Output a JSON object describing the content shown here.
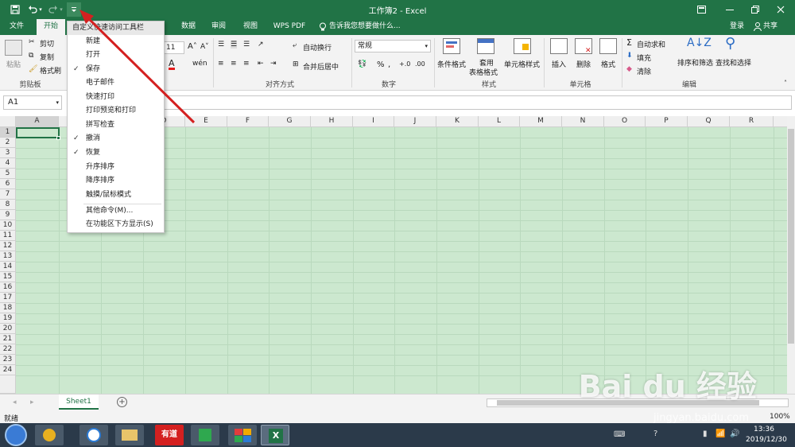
{
  "window": {
    "title": "工作簿2 - Excel",
    "login": "登录",
    "share": "共享"
  },
  "tabs": [
    {
      "label": "文件",
      "active": false
    },
    {
      "label": "开始",
      "active": true
    },
    {
      "label": "数据",
      "active": false
    },
    {
      "label": "审阅",
      "active": false
    },
    {
      "label": "视图",
      "active": false
    },
    {
      "label": "WPS PDF",
      "active": false
    }
  ],
  "tell_me": "告诉我您想要做什么...",
  "ribbon": {
    "clipboard": {
      "paste": "粘贴",
      "cut": "剪切",
      "copy": "复制",
      "format_painter": "格式刷",
      "group": "剪贴板"
    },
    "font": {
      "size": "11"
    },
    "align": {
      "wrap": "自动换行",
      "merge": "合并后居中",
      "group": "对齐方式"
    },
    "number": {
      "format": "常规",
      "group": "数字",
      "percent": "%"
    },
    "styles": {
      "cond": "条件格式",
      "table_l1": "套用",
      "table_l2": "表格格式",
      "cell": "单元格样式",
      "group": "样式"
    },
    "cells": {
      "insert": "插入",
      "delete": "删除",
      "format": "格式",
      "group": "单元格"
    },
    "editing": {
      "autosum": "自动求和",
      "fill": "填充",
      "clear": "清除",
      "sort": "排序和筛选",
      "find": "查找和选择",
      "group": "编辑"
    }
  },
  "formula_bar": {
    "name_box": "A1"
  },
  "columns": [
    "A",
    "B",
    "C",
    "D",
    "E",
    "F",
    "G",
    "H",
    "I",
    "J",
    "K",
    "L",
    "M",
    "N",
    "O",
    "P",
    "Q",
    "R"
  ],
  "rows": [
    "1",
    "2",
    "3",
    "4",
    "5",
    "6",
    "7",
    "8",
    "9",
    "10",
    "11",
    "12",
    "13",
    "14",
    "15",
    "16",
    "17",
    "18",
    "19",
    "20",
    "21",
    "22",
    "23",
    "24"
  ],
  "sheet_tab": "Sheet1",
  "status": {
    "ready": "就绪",
    "zoom": "100%"
  },
  "qat_menu": {
    "title": "自定义快速访问工具栏",
    "items": [
      {
        "label": "新建",
        "checked": false
      },
      {
        "label": "打开",
        "checked": false
      },
      {
        "label": "保存",
        "checked": true
      },
      {
        "label": "电子邮件",
        "checked": false
      },
      {
        "label": "快速打印",
        "checked": false
      },
      {
        "label": "打印预览和打印",
        "checked": false
      },
      {
        "label": "拼写检查",
        "checked": false
      },
      {
        "label": "撤消",
        "checked": true
      },
      {
        "label": "恢复",
        "checked": true
      },
      {
        "label": "升序排序",
        "checked": false
      },
      {
        "label": "降序排序",
        "checked": false
      },
      {
        "label": "触摸/鼠标模式",
        "checked": false
      }
    ],
    "more": "其他命令(M)...",
    "below": "在功能区下方显示(S)"
  },
  "taskbar": {
    "time": "13:36",
    "date": "2019/12/30",
    "youdao": "有道"
  },
  "watermark": {
    "brand": "Bai du 经验",
    "url": "jingyan.baidu.com"
  },
  "colors": {
    "excel_green": "#217346",
    "sheet_bg": "#cce8cf",
    "arrow": "#d42020"
  },
  "icons": [
    "save-icon",
    "undo-icon",
    "redo-icon",
    "customize-qat-icon",
    "restore-icon",
    "minimize-icon",
    "maximize-icon",
    "close-icon",
    "lightbulb-icon",
    "user-icon"
  ]
}
